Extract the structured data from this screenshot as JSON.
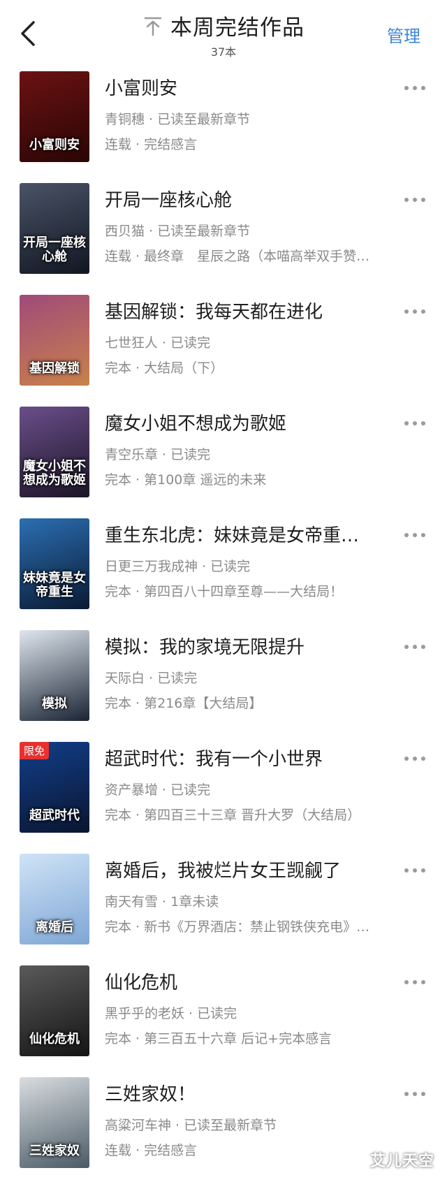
{
  "header": {
    "title": "本周完结作品",
    "subtitle": "37本",
    "manage_label": "管理"
  },
  "icons": {
    "back": "chevron-left-icon",
    "pin": "arrow-up-to-line-icon",
    "more": "more-horizontal-icon"
  },
  "colors": {
    "accent": "#3e86d9",
    "secondary_text": "#8a8a8a",
    "badge": "#e8312f"
  },
  "books": [
    {
      "title": "小富则安",
      "meta": "青铜穗 · 已读至最新章节",
      "chapter": "连载 · 完结感言",
      "cover_text": "小富则安",
      "cover_colors": [
        "#6b1212",
        "#2a0505"
      ]
    },
    {
      "title": "开局一座核心舱",
      "meta": "西贝猫 · 已读至最新章节",
      "chapter": "连载 · 最终章　星辰之路（本喵高举双手赞…",
      "cover_text": "开局一座核心舱",
      "cover_colors": [
        "#4a5366",
        "#111622"
      ]
    },
    {
      "title": "基因解锁：我每天都在进化",
      "meta": "七世狂人 · 已读完",
      "chapter": "完本 · 大结局（下）",
      "cover_text": "基因解锁",
      "cover_colors": [
        "#a04a7a",
        "#c9824a"
      ]
    },
    {
      "title": "魔女小姐不想成为歌姬",
      "meta": "青空乐章 · 已读完",
      "chapter": "完本 · 第100章 遥远的未来",
      "cover_text": "魔女小姐不想成为歌姬",
      "cover_colors": [
        "#6a4e8a",
        "#1c1526"
      ]
    },
    {
      "title": "重生东北虎：妹妹竟是女帝重…",
      "meta": "日更三万我成神 · 已读完",
      "chapter": "完本 · 第四百八十四章至尊——大结局！",
      "cover_text": "妹妹竟是女帝重生",
      "cover_colors": [
        "#2b6fb2",
        "#0a1a33"
      ]
    },
    {
      "title": "模拟：我的家境无限提升",
      "meta": "天际白 · 已读完",
      "chapter": "完本 · 第216章【大结局】",
      "cover_text": "模拟",
      "cover_colors": [
        "#dfe6ef",
        "#1a2433"
      ]
    },
    {
      "title": "超武时代：我有一个小世界",
      "meta": "资产暴增 · 已读完",
      "chapter": "完本 · 第四百三十三章 晋升大罗（大结局）",
      "cover_text": "超武时代",
      "cover_colors": [
        "#123f8a",
        "#0a1530"
      ],
      "badge": "限免"
    },
    {
      "title": "离婚后，我被烂片女王觊觎了",
      "meta": "南天有雪 · 1章未读",
      "chapter": "完本 · 新书《万界酒店：禁止钢铁侠充电》…",
      "cover_text": "离婚后",
      "cover_colors": [
        "#cfe3f7",
        "#7ea6d4"
      ]
    },
    {
      "title": "仙化危机",
      "meta": "黑乎乎的老妖 · 已读完",
      "chapter": "完本 · 第三百五十六章 后记+完本感言",
      "cover_text": "仙化危机",
      "cover_colors": [
        "#5a5a5a",
        "#141414"
      ]
    },
    {
      "title": "三姓家奴！",
      "meta": "高粱河车神 · 已读至最新章节",
      "chapter": "连载 · 完结感言",
      "cover_text": "三姓家奴",
      "cover_colors": [
        "#d9dde0",
        "#4a5a66"
      ]
    }
  ],
  "watermark": "艾儿天空"
}
